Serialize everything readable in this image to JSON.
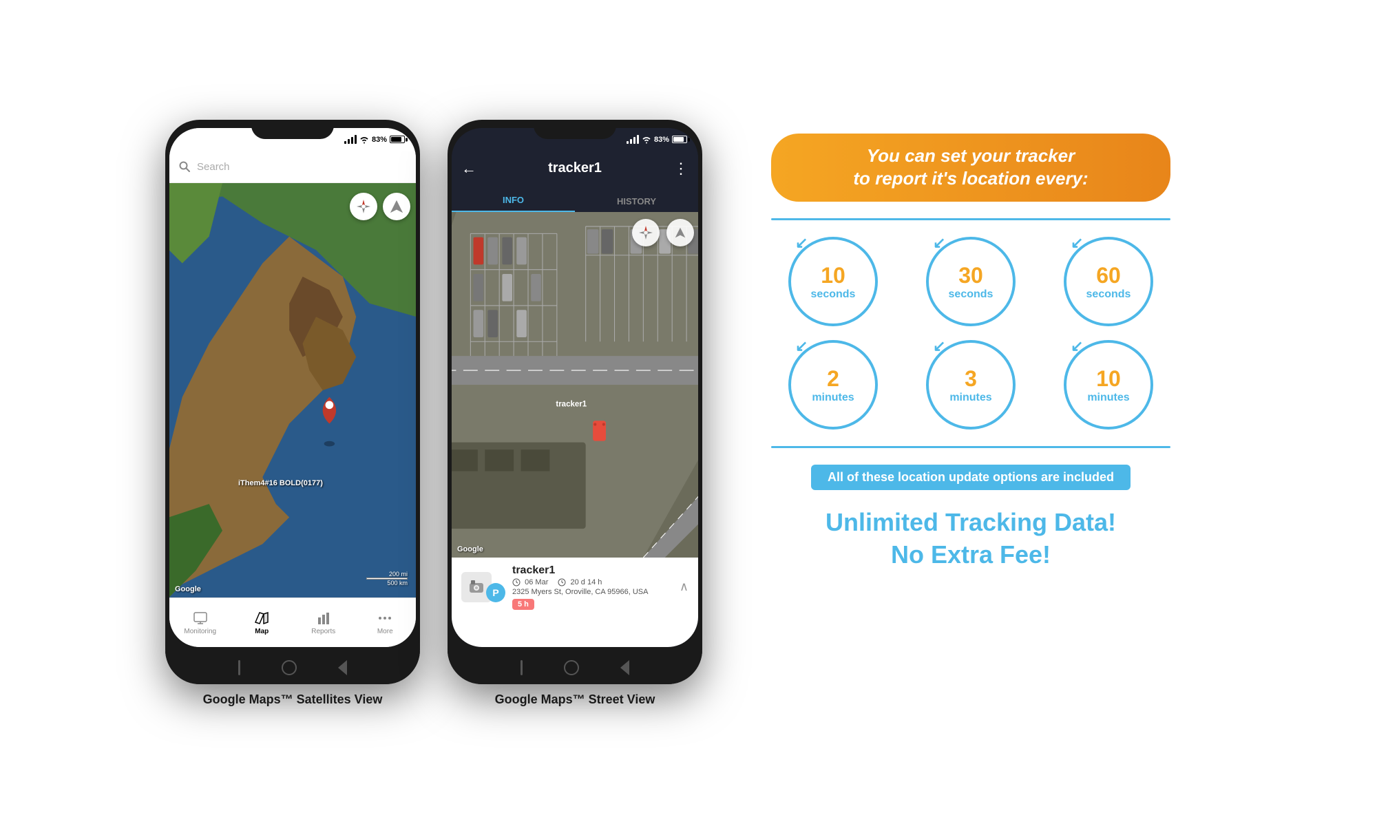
{
  "phone1": {
    "status": {
      "time": "",
      "signal": "●●●",
      "wifi": "WiFi",
      "battery": "83%"
    },
    "search_placeholder": "Search",
    "map_label": "Google",
    "scale1": "200 mi",
    "scale2": "500 km",
    "location_label": "iThem4#16 BOLD(0177)",
    "bottom_nav": [
      {
        "icon": "monitor-icon",
        "label": "Monitoring",
        "active": false
      },
      {
        "icon": "map-icon",
        "label": "Map",
        "active": true
      },
      {
        "icon": "chart-icon",
        "label": "Reports",
        "active": false
      },
      {
        "icon": "more-icon",
        "label": "More",
        "active": false
      }
    ]
  },
  "phone2": {
    "status": {
      "time": "",
      "signal": "●●●",
      "wifi": "WiFi",
      "battery": "83%"
    },
    "title": "tracker1",
    "tabs": [
      "INFO",
      "HISTORY"
    ],
    "active_tab": 0,
    "tracker_name": "tracker1",
    "tracker_avatar_letter": "P",
    "date": "06 Mar",
    "duration": "20 d 14 h",
    "address": "2325 Myers St, Oroville, CA 95966, USA",
    "badge": "5 h",
    "map_label": "Google",
    "tracker_label": "tracker1"
  },
  "right_panel": {
    "banner_line1": "You can set your tracker",
    "banner_line2": "to report it's location every:",
    "teal_line": true,
    "time_options": [
      {
        "number": "10",
        "unit": "seconds"
      },
      {
        "number": "30",
        "unit": "seconds"
      },
      {
        "number": "60",
        "unit": "seconds"
      },
      {
        "number": "2",
        "unit": "minutes"
      },
      {
        "number": "3",
        "unit": "minutes"
      },
      {
        "number": "10",
        "unit": "minutes"
      }
    ],
    "included_text": "All of these location update options are included",
    "unlimited_line1": "Unlimited Tracking Data!",
    "unlimited_line2": "No Extra Fee!"
  },
  "caption1": "Google Maps™ Satellites View",
  "caption2": "Google Maps™ Street View"
}
